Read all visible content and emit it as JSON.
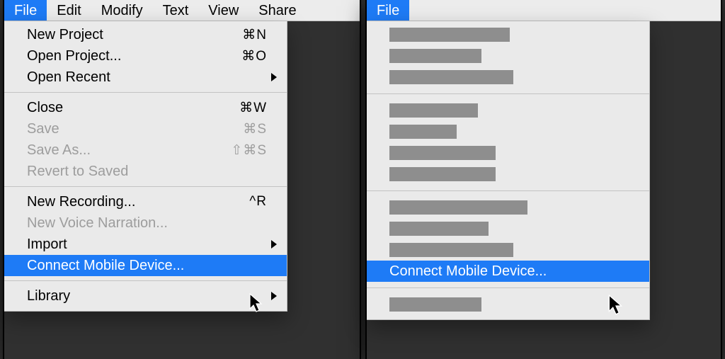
{
  "menubar": {
    "items": [
      "File",
      "Edit",
      "Modify",
      "Text",
      "View",
      "Share"
    ],
    "active_index": 0
  },
  "file_menu": {
    "groups": [
      [
        {
          "label": "New Project",
          "shortcut": "⌘N"
        },
        {
          "label": "Open Project...",
          "shortcut": "⌘O"
        },
        {
          "label": "Open Recent",
          "submenu": true
        }
      ],
      [
        {
          "label": "Close",
          "shortcut": "⌘W"
        },
        {
          "label": "Save",
          "shortcut": "⌘S",
          "disabled": true
        },
        {
          "label": "Save As...",
          "shortcut": "⇧⌘S",
          "disabled": true
        },
        {
          "label": "Revert to Saved",
          "disabled": true
        }
      ],
      [
        {
          "label": "New Recording...",
          "shortcut": "^R"
        },
        {
          "label": "New Voice Narration...",
          "disabled": true
        },
        {
          "label": "Import",
          "submenu": true
        },
        {
          "label": "Connect Mobile Device...",
          "highlight": true
        }
      ],
      [
        {
          "label": "Library",
          "submenu": true
        }
      ]
    ]
  },
  "redacted_menu": {
    "highlight_label": "Connect Mobile Device...",
    "groups_placeholder_widths": [
      [
        170,
        130,
        175
      ],
      [
        125,
        95,
        150,
        150
      ],
      [
        195,
        140,
        175,
        "HIGHLIGHT"
      ],
      [
        130
      ]
    ]
  }
}
